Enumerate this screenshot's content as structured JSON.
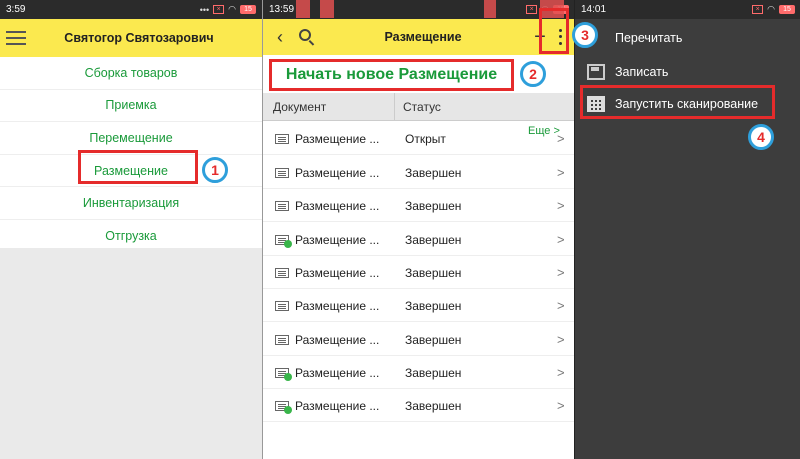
{
  "panel1": {
    "time": "3:59",
    "header_title": "Святогор Святозарович",
    "menu": [
      "Сборка товаров",
      "Приемка",
      "Перемещение",
      "Размещение",
      "Инвентаризация",
      "Отгрузка"
    ]
  },
  "panel2": {
    "time": "13:59",
    "header_title": "Размещение",
    "new_button": "Начать новое Размещение",
    "columns": [
      "Документ",
      "Статус"
    ],
    "rows": [
      {
        "doc": "Размещение ...",
        "status": "Открыт"
      },
      {
        "doc": "Размещение ...",
        "status": "Завершен"
      },
      {
        "doc": "Размещение ...",
        "status": "Завершен"
      },
      {
        "doc": "Размещение ...",
        "status": "Завершен"
      },
      {
        "doc": "Размещение ...",
        "status": "Завершен"
      },
      {
        "doc": "Размещение ...",
        "status": "Завершен"
      },
      {
        "doc": "Размещение ...",
        "status": "Завершен"
      },
      {
        "doc": "Размещение ...",
        "status": "Завершен"
      },
      {
        "doc": "Размещение ...",
        "status": "Завершен"
      }
    ],
    "more_label": "Еще"
  },
  "panel3": {
    "time": "14:01",
    "menu": [
      "Перечитать",
      "Записать",
      "Запустить сканирование"
    ]
  },
  "status": {
    "battery": "15"
  },
  "steps": [
    "1",
    "2",
    "3",
    "4"
  ]
}
